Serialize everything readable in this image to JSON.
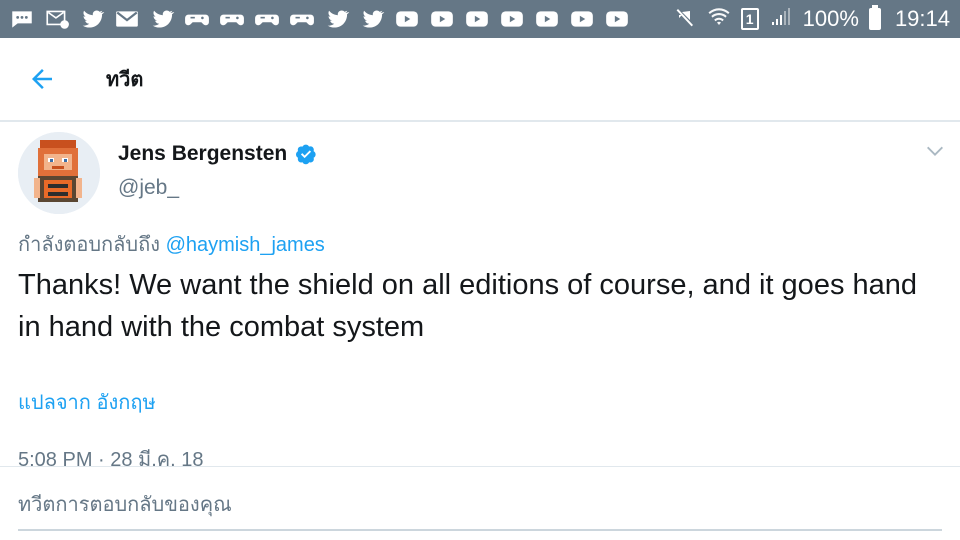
{
  "status_bar": {
    "notification_icons": [
      "message-icon",
      "email-icon",
      "twitter-icon",
      "mail-icon",
      "twitter-icon",
      "game-controller-icon",
      "game-controller-icon",
      "game-controller-icon",
      "game-controller-icon",
      "twitter-icon",
      "twitter-icon",
      "youtube-icon",
      "youtube-icon",
      "youtube-icon",
      "youtube-icon",
      "youtube-icon",
      "youtube-icon",
      "youtube-icon"
    ],
    "sim_label": "1",
    "battery_text": "100%",
    "time": "19:14"
  },
  "header": {
    "title": "ทวีต"
  },
  "tweet": {
    "author_name": "Jens Bergensten",
    "author_handle": "@jeb_",
    "reply_prefix": "กำลังตอบกลับถึง",
    "reply_mention": "@haymish_james",
    "text": "Thanks! We want the shield on all editions of course, and it goes hand in hand with the combat system",
    "translate_label": "แปลจาก อังกฤษ",
    "timestamp": "5:08 PM · 28 มี.ค. 18"
  },
  "reply": {
    "placeholder": "ทวีตการตอบกลับของคุณ"
  },
  "colors": {
    "status_bar": "#657786",
    "accent": "#1da1f2",
    "text": "#14171a",
    "secondary_text": "#657786"
  }
}
